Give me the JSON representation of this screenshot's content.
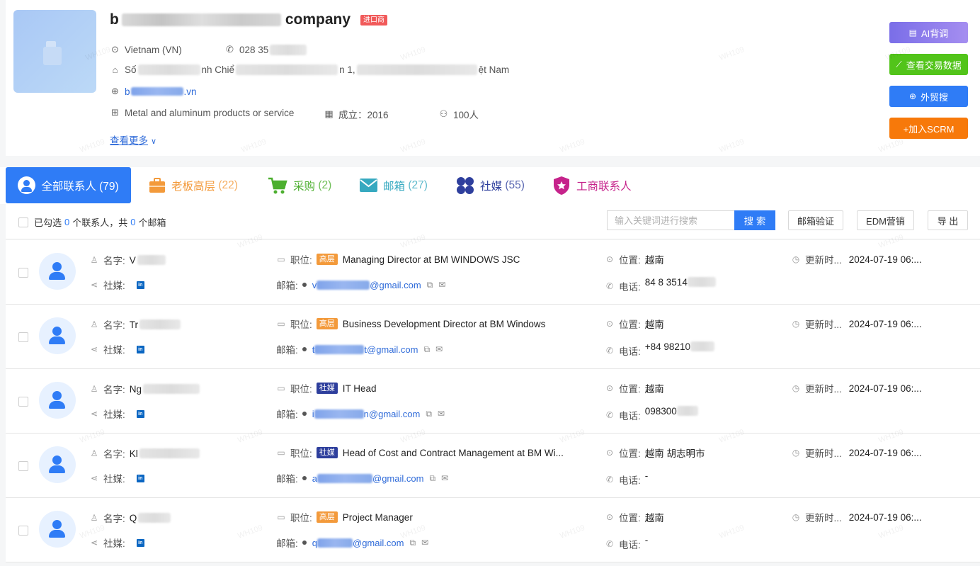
{
  "company": {
    "name_prefix": "b",
    "name_suffix": "company",
    "tag": "进口商",
    "country": "Vietnam (VN)",
    "phone_prefix": "028 35",
    "address_prefix": "Số",
    "address_mid": "nh Chiể",
    "address_mid2": "n 1,",
    "address_suffix": "ệt Nam",
    "website_prefix": "b",
    "website_suffix": ".vn",
    "industry": "Metal and aluminum products or service",
    "founded": "成立：2016",
    "employees": "100人",
    "see_more": "查看更多"
  },
  "actions": {
    "ai": "AI背调",
    "trade": "查看交易数据",
    "search": "外贸搜",
    "scrm": "+加入SCRM"
  },
  "tabs": {
    "all": "全部联系人 (79)",
    "boss_label": "老板高层",
    "boss_count": "(22)",
    "buy_label": "采购",
    "buy_count": "(2)",
    "mail_label": "邮箱",
    "mail_count": "(27)",
    "social_label": "社媒",
    "social_count": "(55)",
    "biz_label": "工商联系人"
  },
  "toolbar": {
    "selected_prefix": "已勾选",
    "selected_count": "0",
    "selected_mid": "个联系人，共",
    "email_count": "0",
    "selected_suffix": "个邮箱",
    "search_placeholder": "输入关键词进行搜索",
    "search_button": "搜 索",
    "verify_button": "邮箱验证",
    "edm_button": "EDM营销",
    "export_button": "导 出"
  },
  "labels": {
    "name": "名字:",
    "social": "社媒:",
    "position": "职位:",
    "email": "邮箱:",
    "location": "位置:",
    "phone": "电话:",
    "updated": "更新时..."
  },
  "contacts": [
    {
      "name": "V",
      "badge": "高层",
      "badge_type": "senior",
      "position": "Managing Director at BM WINDOWS JSC",
      "email_prefix": "v",
      "email_suffix": "@gmail.com",
      "location": "越南",
      "phone": "84 8 3514",
      "updated": "2024-07-19 06:..."
    },
    {
      "name": "Tr",
      "badge": "高层",
      "badge_type": "senior",
      "position": "Business Development Director at BM Windows",
      "email_prefix": "t",
      "email_suffix": "t@gmail.com",
      "location": "越南",
      "phone": "+84 98210",
      "updated": "2024-07-19 06:..."
    },
    {
      "name": "Ng",
      "badge": "社媒",
      "badge_type": "social",
      "position": "IT Head",
      "email_prefix": "i",
      "email_suffix": "n@gmail.com",
      "location": "越南",
      "phone": "098300",
      "updated": "2024-07-19 06:..."
    },
    {
      "name": "Kl",
      "badge": "社媒",
      "badge_type": "social",
      "position": "Head of Cost and Contract Management at BM Wi...",
      "email_prefix": "a",
      "email_suffix": "@gmail.com",
      "location": "越南 胡志明市",
      "phone": "-",
      "updated": "2024-07-19 06:..."
    },
    {
      "name": "Q",
      "badge": "高层",
      "badge_type": "senior",
      "position": "Project Manager",
      "email_prefix": "q",
      "email_suffix": "@gmail.com",
      "location": "越南",
      "phone": "-",
      "updated": "2024-07-19 06:..."
    }
  ],
  "watermark": "WH109"
}
